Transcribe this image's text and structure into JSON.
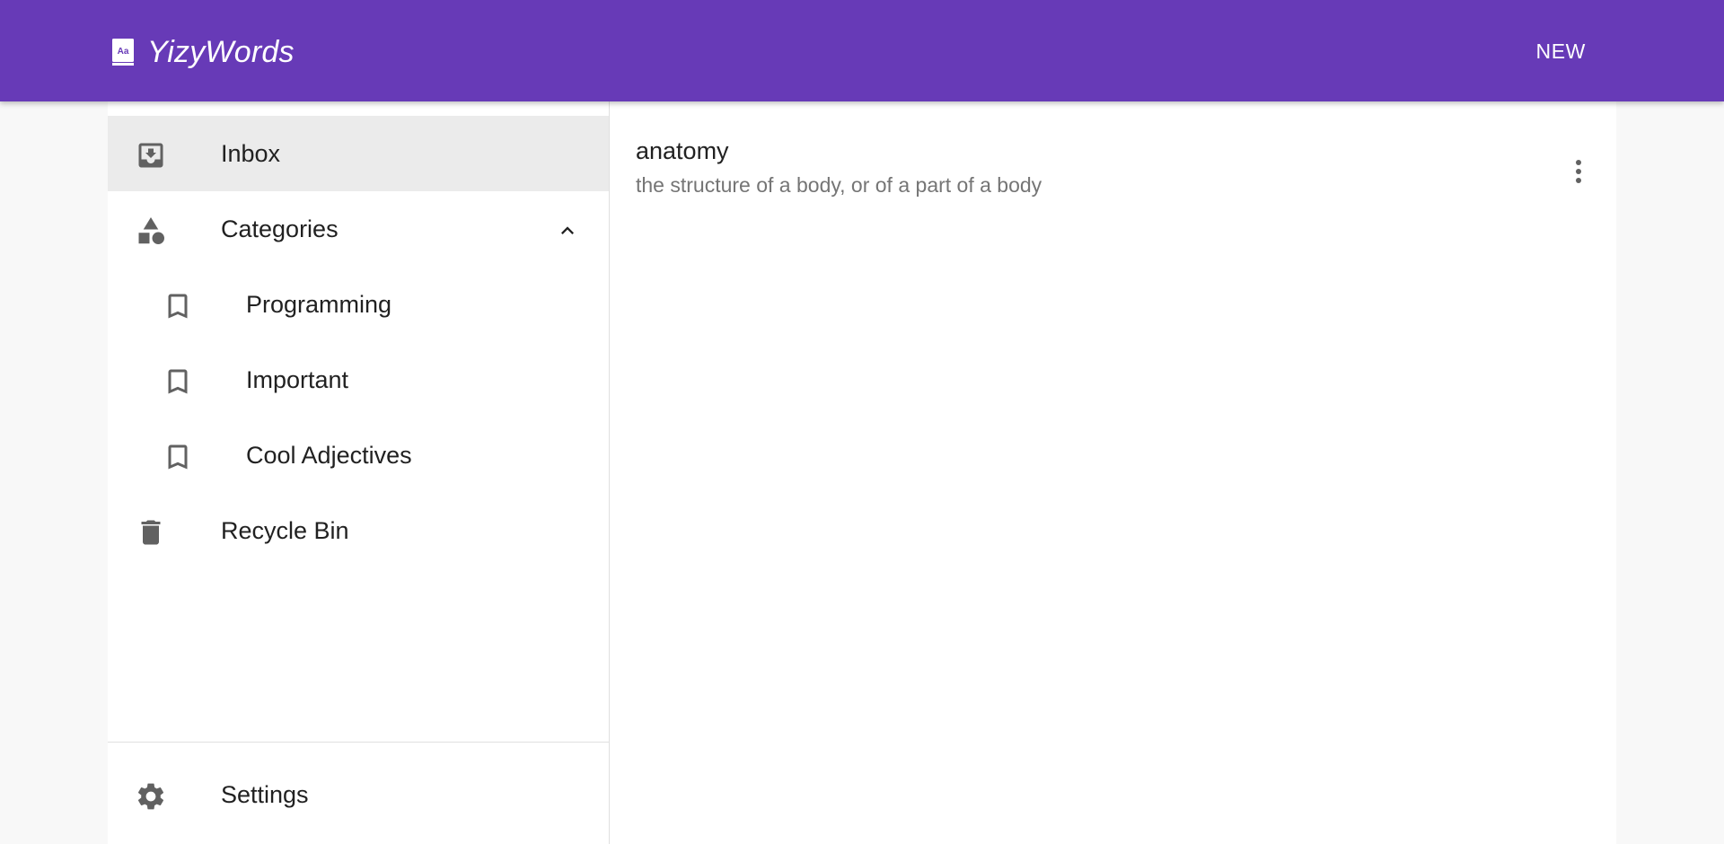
{
  "app": {
    "title": "YizyWords",
    "new_label": "NEW",
    "brand_color": "#673ab7"
  },
  "sidebar": {
    "items": [
      {
        "label": "Inbox",
        "icon": "inbox-icon",
        "active": true
      },
      {
        "label": "Categories",
        "icon": "shapes-icon",
        "expanded": true
      },
      {
        "label": "Programming",
        "icon": "bookmark-icon"
      },
      {
        "label": "Important",
        "icon": "bookmark-icon"
      },
      {
        "label": "Cool Adjectives",
        "icon": "bookmark-icon"
      },
      {
        "label": "Recycle Bin",
        "icon": "delete-icon"
      }
    ],
    "settings_label": "Settings"
  },
  "words": [
    {
      "word": "anatomy",
      "definition": "the structure of a body, or of a part of a body"
    }
  ]
}
